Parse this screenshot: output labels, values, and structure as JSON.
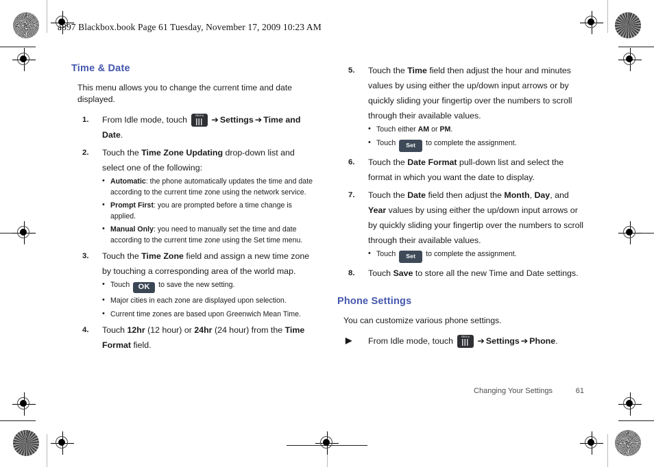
{
  "header": {
    "stamp": "a897 Blackbox.book  Page 61  Tuesday, November 17, 2009  10:23 AM"
  },
  "colors": {
    "heading": "#4456ac",
    "body_text": "#1a1a1a",
    "key_dark": "#2f3034",
    "button_slate": "#3e4a58",
    "footer_text": "#4c4c4c"
  },
  "icons": {
    "menu_key_label": "Menu",
    "ok_button": "OK",
    "set_button": "Set",
    "arrow": "➔",
    "triangle_bullet": "▶"
  },
  "left_column": {
    "heading": "Time & Date",
    "intro": "This menu allows you to change the current time and date displayed.",
    "steps": [
      {
        "num": "1.",
        "parts": [
          {
            "type": "text",
            "value": "From Idle mode, touch "
          },
          {
            "type": "menu-key"
          },
          {
            "type": "arrow"
          },
          {
            "type": "bold",
            "value": "Settings"
          },
          {
            "type": "arrow"
          },
          {
            "type": "bold",
            "value": "Time and Date"
          },
          {
            "type": "text",
            "value": "."
          }
        ],
        "subbullets": []
      },
      {
        "num": "2.",
        "parts": [
          {
            "type": "text",
            "value": "Touch the "
          },
          {
            "type": "bold",
            "value": "Time Zone Updating"
          },
          {
            "type": "text",
            "value": " drop-down list and select one of the following:"
          }
        ],
        "subbullets": [
          {
            "parts": [
              {
                "type": "bold",
                "value": "Automatic"
              },
              {
                "type": "text",
                "value": ": the phone automatically updates the time and date according to the current time zone using the network service."
              }
            ]
          },
          {
            "parts": [
              {
                "type": "bold",
                "value": "Prompt First"
              },
              {
                "type": "text",
                "value": ": you are prompted before a time change is applied."
              }
            ]
          },
          {
            "parts": [
              {
                "type": "bold",
                "value": "Manual Only"
              },
              {
                "type": "text",
                "value": ": you need to manually set the time and date according to the current time zone using the Set time menu."
              }
            ]
          }
        ]
      },
      {
        "num": "3.",
        "parts": [
          {
            "type": "text",
            "value": "Touch the "
          },
          {
            "type": "bold",
            "value": "Time Zone"
          },
          {
            "type": "text",
            "value": " field and assign a new time zone by touching a corresponding area of the world map."
          }
        ],
        "subbullets": [
          {
            "parts": [
              {
                "type": "text",
                "value": "Touch "
              },
              {
                "type": "ok-key"
              },
              {
                "type": "text",
                "value": " to save the new setting."
              }
            ]
          },
          {
            "parts": [
              {
                "type": "text",
                "value": "Major cities in each zone are displayed upon selection."
              }
            ]
          },
          {
            "parts": [
              {
                "type": "text",
                "value": "Current time zones are based upon Greenwich Mean Time."
              }
            ]
          }
        ]
      },
      {
        "num": "4.",
        "parts": [
          {
            "type": "text",
            "value": "Touch "
          },
          {
            "type": "bold",
            "value": "12hr"
          },
          {
            "type": "text",
            "value": " (12 hour) or "
          },
          {
            "type": "bold",
            "value": "24hr"
          },
          {
            "type": "text",
            "value": " (24 hour) from the "
          },
          {
            "type": "bold",
            "value": "Time Format"
          },
          {
            "type": "text",
            "value": " field."
          }
        ],
        "subbullets": []
      }
    ]
  },
  "right_column": {
    "steps": [
      {
        "num": "5.",
        "parts": [
          {
            "type": "text",
            "value": "Touch the "
          },
          {
            "type": "bold",
            "value": "Time"
          },
          {
            "type": "text",
            "value": " field then adjust the hour and minutes values by using either the up/down input arrows or by quickly sliding your fingertip over the numbers to scroll through their available values."
          }
        ],
        "subbullets": [
          {
            "parts": [
              {
                "type": "text",
                "value": "Touch either "
              },
              {
                "type": "bold",
                "value": "AM"
              },
              {
                "type": "text",
                "value": " or "
              },
              {
                "type": "bold",
                "value": "PM"
              },
              {
                "type": "text",
                "value": "."
              }
            ]
          },
          {
            "parts": [
              {
                "type": "text",
                "value": "Touch "
              },
              {
                "type": "set-key"
              },
              {
                "type": "text",
                "value": " to complete the assignment."
              }
            ]
          }
        ]
      },
      {
        "num": "6.",
        "parts": [
          {
            "type": "text",
            "value": "Touch the "
          },
          {
            "type": "bold",
            "value": "Date Format"
          },
          {
            "type": "text",
            "value": " pull-down list and select the format in which you want the date to display."
          }
        ],
        "subbullets": []
      },
      {
        "num": "7.",
        "parts": [
          {
            "type": "text",
            "value": "Touch the "
          },
          {
            "type": "bold",
            "value": "Date"
          },
          {
            "type": "text",
            "value": " field then adjust the "
          },
          {
            "type": "bold",
            "value": "Month"
          },
          {
            "type": "text",
            "value": ", "
          },
          {
            "type": "bold",
            "value": "Day"
          },
          {
            "type": "text",
            "value": ", and "
          },
          {
            "type": "bold",
            "value": "Year"
          },
          {
            "type": "text",
            "value": " values by using either the up/down input arrows or by quickly sliding your fingertip over the numbers to scroll through their available values."
          }
        ],
        "subbullets": [
          {
            "parts": [
              {
                "type": "text",
                "value": "Touch "
              },
              {
                "type": "set-key"
              },
              {
                "type": "text",
                "value": " to complete the assignment."
              }
            ]
          }
        ]
      },
      {
        "num": "8.",
        "parts": [
          {
            "type": "text",
            "value": "Touch "
          },
          {
            "type": "bold",
            "value": "Save"
          },
          {
            "type": "text",
            "value": " to store all the new Time and Date settings."
          }
        ],
        "subbullets": []
      }
    ],
    "heading": "Phone Settings",
    "intro": "You can customize various phone settings.",
    "arrow_step": {
      "num": "▶",
      "parts": [
        {
          "type": "text",
          "value": "From Idle mode, touch "
        },
        {
          "type": "menu-key"
        },
        {
          "type": "arrow"
        },
        {
          "type": "bold",
          "value": "Settings"
        },
        {
          "type": "arrow"
        },
        {
          "type": "bold",
          "value": "Phone"
        },
        {
          "type": "text",
          "value": "."
        }
      ]
    }
  },
  "footer": {
    "text": "Changing Your Settings",
    "page": "61"
  }
}
